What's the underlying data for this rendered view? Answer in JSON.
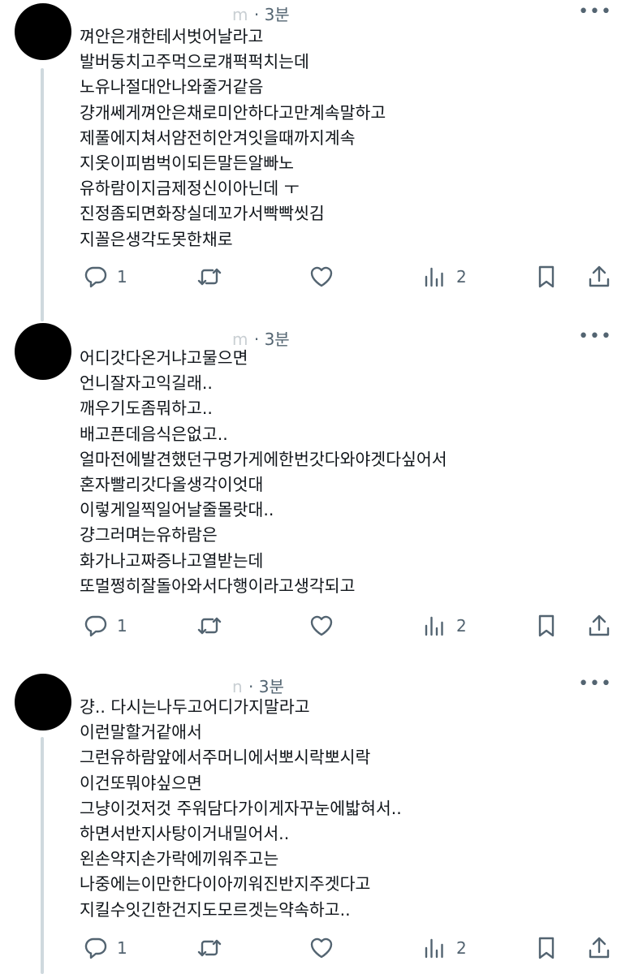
{
  "posts": [
    {
      "handle": "m",
      "time": "3분",
      "lines": [
        "껴안은걔한테서벗어날라고",
        "발버둥치고주먹으로걔퍽퍽치는데",
        "노유나절대안나와줄거같음",
        "걍개쎄게껴안은채로미안하다고만계속말하고",
        "제풀에지쳐서얌전히안겨잇을때까지계속",
        "지옷이피범벅이되든말든알빠노",
        "유하람이지금제정신이아닌데 ㅜ",
        "진정좀되면화장실데꼬가서빡빡씻김",
        "지꼴은생각도못한채로"
      ],
      "replies": "1",
      "views": "2"
    },
    {
      "handle": "m",
      "time": "3분",
      "lines": [
        "어디갓다온거냐고물으면",
        "언니잘자고익길래..",
        "깨우기도좀뭐하고..",
        "배고픈데음식은없고..",
        "얼마전에발견했던구멍가게에한번갓다와야겟다싶어서",
        "혼자빨리갓다올생각이엇대",
        "이렇게일찍일어날줄몰랏대..",
        "걍그러며는유하람은",
        "화가나고짜증나고열받는데",
        "또멀쩡히잘돌아와서다행이라고생각되고"
      ],
      "replies": "1",
      "views": "2"
    },
    {
      "handle": "n",
      "time": "3분",
      "lines": [
        "걍.. 다시는나두고어디가지말라고",
        "이런말할거같애서",
        "그런유하람앞에서주머니에서뽀시락뽀시락",
        "이건또뭐야싶으면",
        "그냥이것저것 주워담다가이게자꾸눈에밟혀서..",
        "하면서반지사탕이거내밀어서..",
        "왼손약지손가락에끼워주고는",
        "나중에는이만한다이아끼워진반지주겟다고",
        "지킬수잇긴한건지도모르겟는약속하고.."
      ],
      "replies": "1",
      "views": "2"
    }
  ],
  "icons": {
    "reply": "reply-icon",
    "repost": "repost-icon",
    "like": "heart-icon",
    "views": "views-icon",
    "bookmark": "bookmark-icon",
    "share": "share-icon",
    "more": "more-icon"
  },
  "colors": {
    "text": "#0f1419",
    "secondary": "#536471",
    "thread": "#cfd9de"
  }
}
